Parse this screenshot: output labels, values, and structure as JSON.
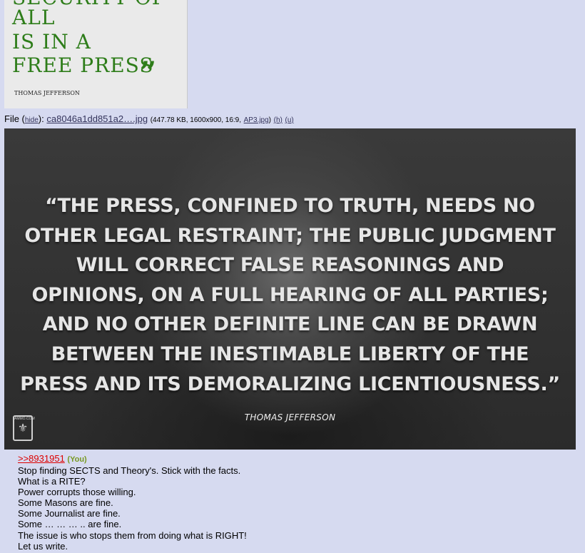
{
  "thumbnail": {
    "lines": [
      "SECURITY OF",
      "ALL",
      "IS IN A",
      "FREE PRESS"
    ],
    "closing_quote": "”",
    "author": "THOMAS JEFFERSON"
  },
  "file": {
    "prefix": "File (",
    "hide_label": "hide",
    "sep": "):",
    "filename": "ca8046a1dd851a2….jpg",
    "meta_open": "(447.78 KB, 1600x900, 16:9,",
    "alt_name": "AP3.jpg",
    "meta_close": ")",
    "h_label": "(h)",
    "u_label": "(u)"
  },
  "image": {
    "quote": "“THE PRESS, CONFINED TO TRUTH, NEEDS NO OTHER LEGAL RESTRAINT; THE PUBLIC JUDGMENT WILL CORRECT FALSE REASONINGS AND OPINIONS, ON A FULL HEARING OF ALL PARTIES; AND NO OTHER DEFINITE LINE CAN BE DRAWN BETWEEN THE INESTIMABLE LIBERTY OF THE PRESS AND ITS DEMORALIZING LICENTIOUSNESS.”",
    "attribution": "THOMAS JEFFERSON",
    "logo_text": "AMMO.COM"
  },
  "reply": {
    "quotelink": ">>8931951",
    "you": "(You)",
    "lines": [
      "Stop finding SECTS and Theory's. Stick with the facts.",
      "What is a RITE?",
      "Power corrupts those willing.",
      "Some Masons are fine.",
      "Some Journalist are fine.",
      "Some … … … .. are fine.",
      "The issue is who stops them from doing what is RIGHT!",
      "Let us write."
    ]
  }
}
